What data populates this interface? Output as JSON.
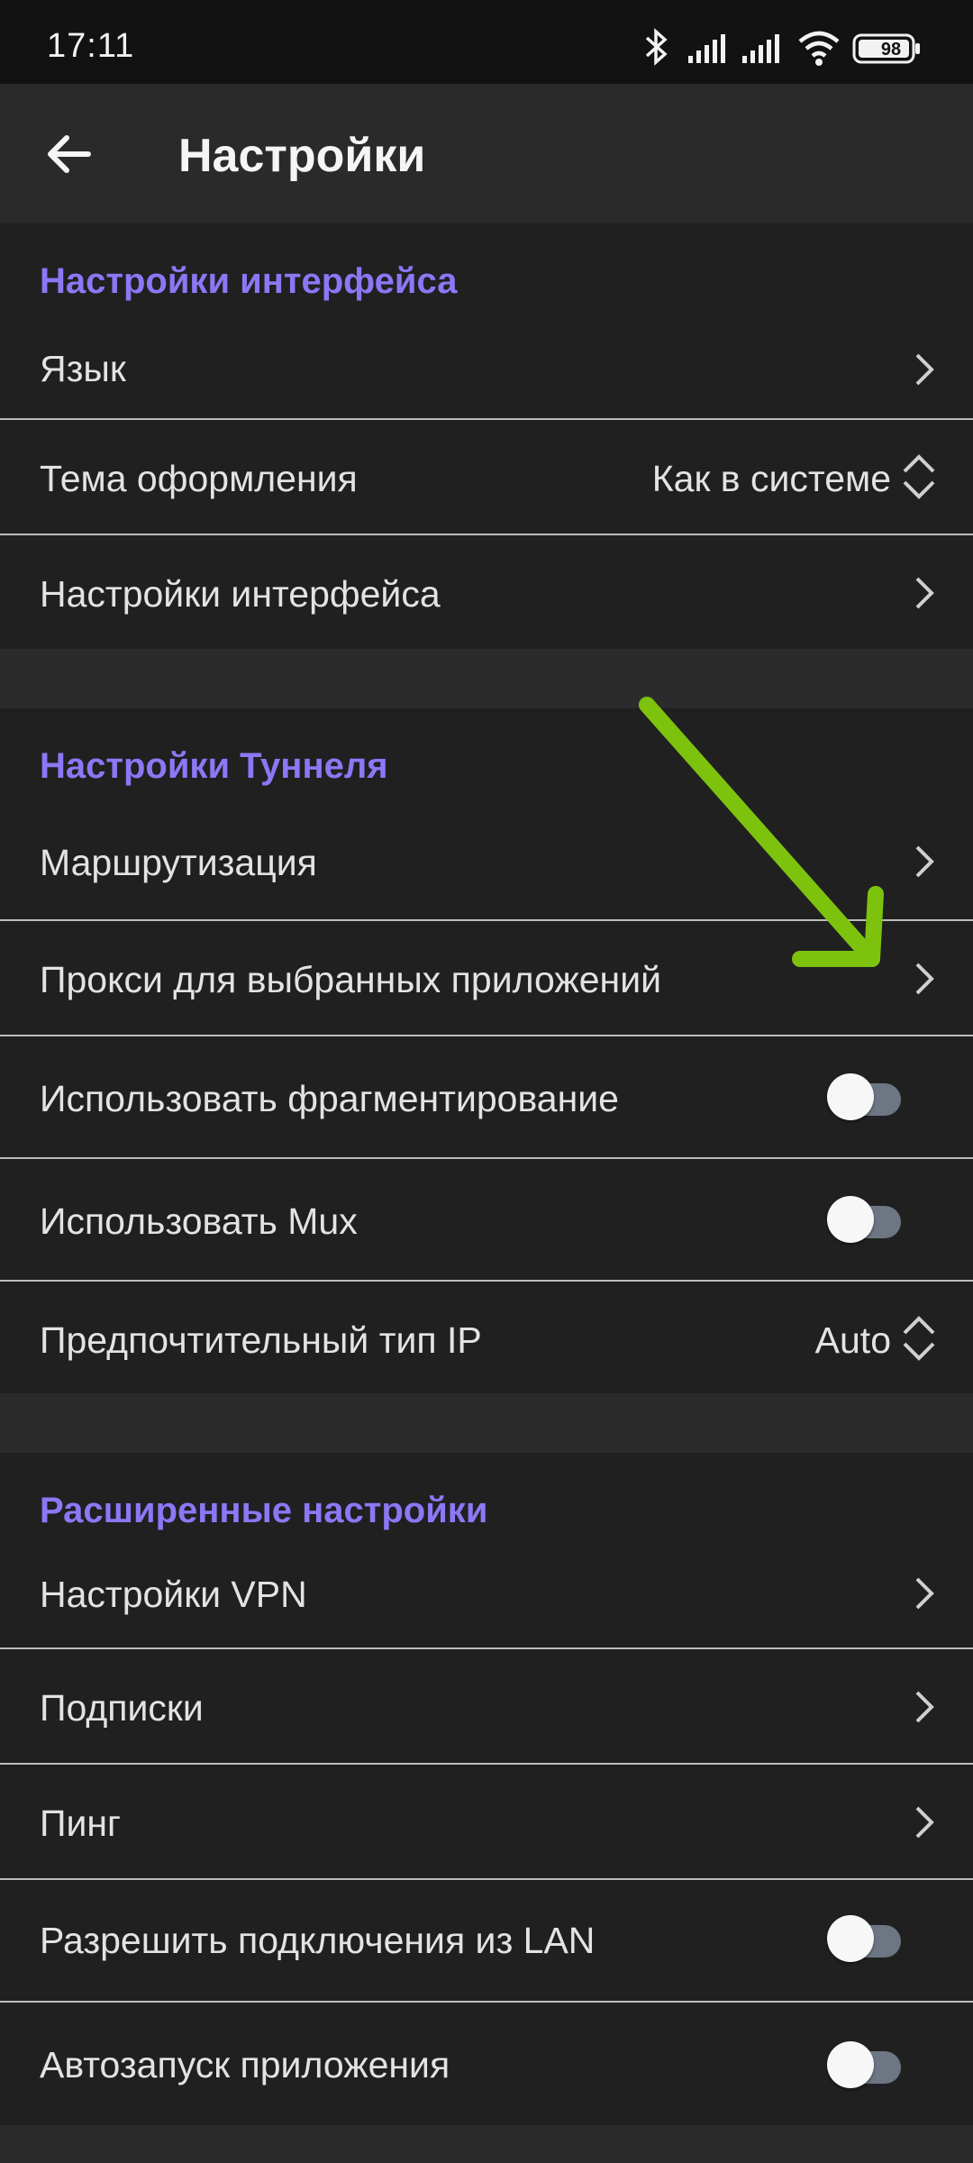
{
  "status_bar": {
    "time": "17:11",
    "battery": "98",
    "icons": [
      "bluetooth-icon",
      "signal-icon",
      "signal-icon",
      "wifi-icon",
      "battery-icon"
    ]
  },
  "toolbar": {
    "title": "Настройки",
    "back_icon": "arrow-left-icon"
  },
  "sections": {
    "interface": {
      "title": "Настройки интерфейса",
      "items": {
        "language": {
          "label": "Язык"
        },
        "theme": {
          "label": "Тема оформления",
          "value": "Как в системе"
        },
        "interface_settings": {
          "label": "Настройки интерфейса"
        }
      }
    },
    "tunnel": {
      "title": "Настройки Туннеля",
      "items": {
        "routing": {
          "label": "Маршрутизация"
        },
        "per_app_proxy": {
          "label": "Прокси для выбранных приложений"
        },
        "fragmentation": {
          "label": "Использовать фрагментирование",
          "enabled": false
        },
        "mux": {
          "label": "Использовать Mux",
          "enabled": false
        },
        "ip_type": {
          "label": "Предпочтительный тип IP",
          "value": "Auto"
        }
      }
    },
    "advanced": {
      "title": "Расширенные настройки",
      "items": {
        "vpn": {
          "label": "Настройки VPN"
        },
        "subscriptions": {
          "label": "Подписки"
        },
        "ping": {
          "label": "Пинг"
        },
        "lan": {
          "label": "Разрешить подключения из LAN",
          "enabled": false
        },
        "autostart": {
          "label": "Автозапуск приложения",
          "enabled": false
        }
      }
    }
  },
  "colors": {
    "accent": "#8a78f5",
    "annotation_arrow": "#7dc20d",
    "toggle_track_off": "#6d7683"
  }
}
